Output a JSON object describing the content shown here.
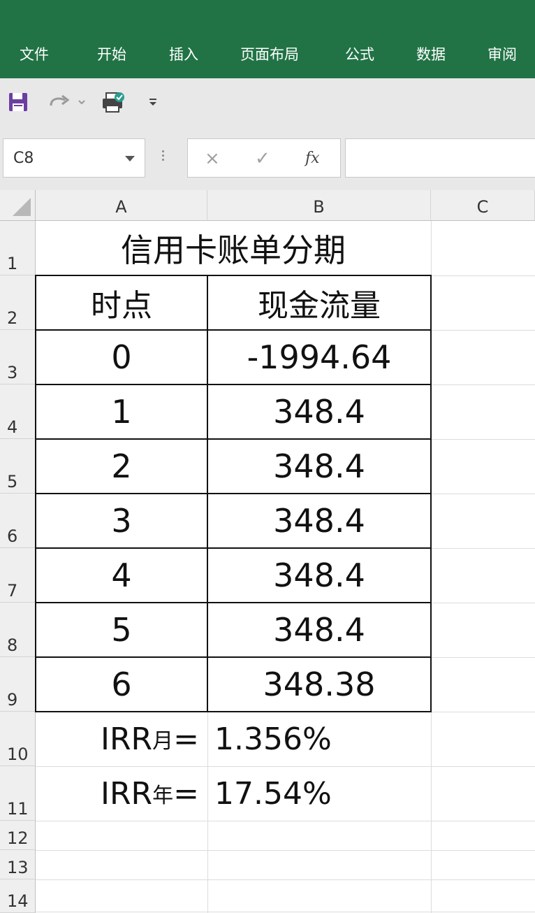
{
  "ribbon": {
    "tabs": [
      "文件",
      "开始",
      "插入",
      "页面布局",
      "公式",
      "数据",
      "审阅"
    ],
    "color": "#217346"
  },
  "quick_access": {
    "icons": [
      "save-icon",
      "redo-icon",
      "print-preview-icon",
      "customize-dropdown-icon"
    ]
  },
  "formula_bar": {
    "name_box": "C8",
    "cancel_glyph": "×",
    "enter_glyph": "✓",
    "fx_label": "fx",
    "formula": ""
  },
  "grid": {
    "columns": [
      "A",
      "B",
      "C"
    ],
    "rows": [
      "1",
      "2",
      "3",
      "4",
      "5",
      "6",
      "7",
      "8",
      "9",
      "10",
      "11",
      "12",
      "13",
      "14"
    ]
  },
  "sheet": {
    "title": "信用卡账单分期",
    "header_time": "时点",
    "header_cashflow": "现金流量",
    "table_rows": [
      {
        "t": "0",
        "cf": "-1994.64"
      },
      {
        "t": "1",
        "cf": "348.4"
      },
      {
        "t": "2",
        "cf": "348.4"
      },
      {
        "t": "3",
        "cf": "348.4"
      },
      {
        "t": "4",
        "cf": "348.4"
      },
      {
        "t": "5",
        "cf": "348.4"
      },
      {
        "t": "6",
        "cf": "348.38"
      }
    ],
    "irr_month": {
      "prefix": "IRR",
      "sub": "月",
      "eq": "=",
      "value": "1.356%"
    },
    "irr_year": {
      "prefix": "IRR",
      "sub": "年",
      "eq": "=",
      "value": "17.54%"
    }
  }
}
